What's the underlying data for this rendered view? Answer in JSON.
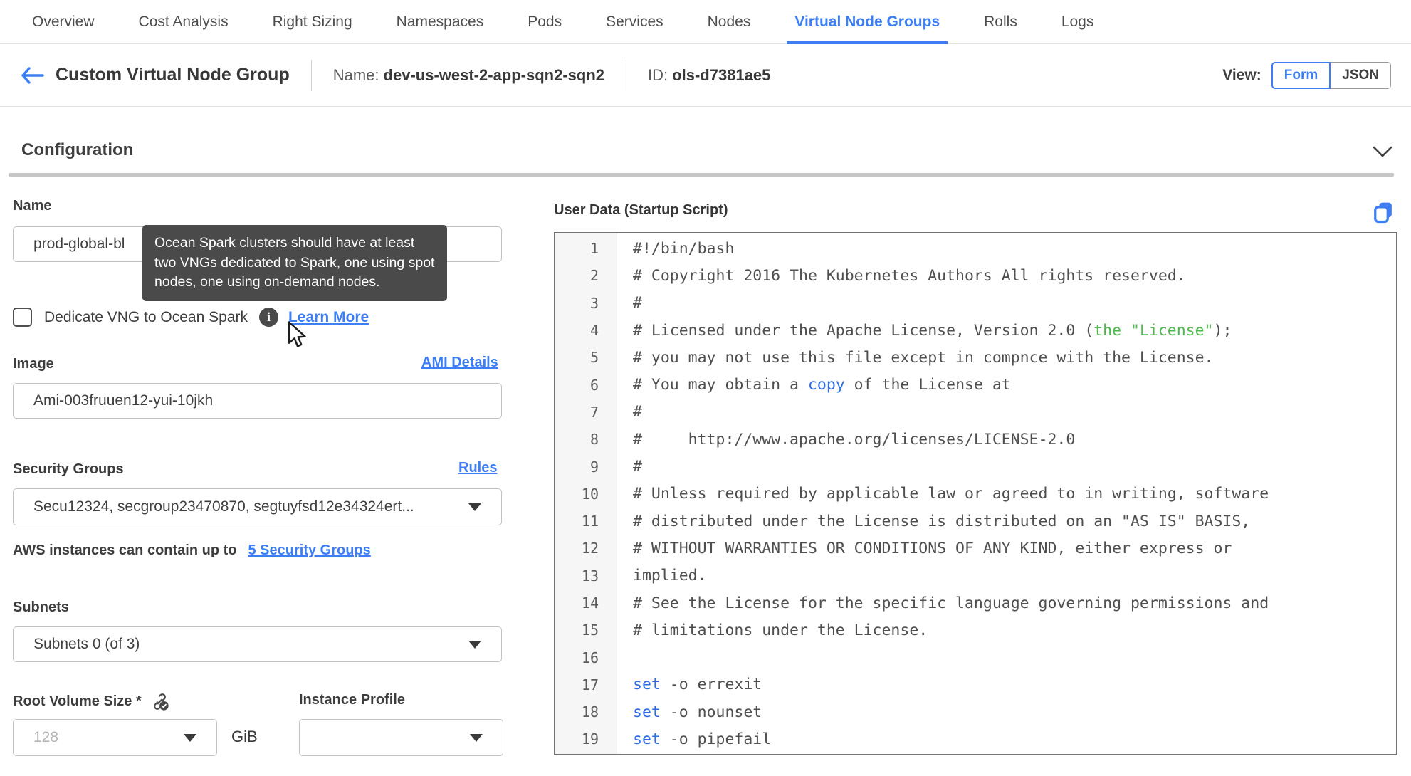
{
  "nav": {
    "tabs": [
      {
        "label": "Overview",
        "active": false
      },
      {
        "label": "Cost Analysis",
        "active": false
      },
      {
        "label": "Right Sizing",
        "active": false
      },
      {
        "label": "Namespaces",
        "active": false
      },
      {
        "label": "Pods",
        "active": false
      },
      {
        "label": "Services",
        "active": false
      },
      {
        "label": "Nodes",
        "active": false
      },
      {
        "label": "Virtual Node Groups",
        "active": true
      },
      {
        "label": "Rolls",
        "active": false
      },
      {
        "label": "Logs",
        "active": false
      }
    ]
  },
  "header": {
    "title": "Custom Virtual Node Group",
    "name_label": "Name:",
    "name_value": "dev-us-west-2-app-sqn2-sqn2",
    "id_label": "ID:",
    "id_value": "ols-d7381ae5",
    "view_label": "View:",
    "view_options": [
      "Form",
      "JSON"
    ],
    "view_selected": "Form"
  },
  "section": {
    "title": "Configuration"
  },
  "form": {
    "name": {
      "label": "Name",
      "value": "prod-global-bl"
    },
    "tooltip": "Ocean Spark clusters should have at least two VNGs dedicated to Spark, one using spot nodes, one using on-demand nodes.",
    "dedicate": {
      "label": "Dedicate VNG to Ocean Spark",
      "checked": false,
      "link": "Learn More"
    },
    "image": {
      "label": "Image",
      "link": "AMI Details",
      "value": "Ami-003fruuen12-yui-10jkh"
    },
    "security_groups": {
      "label": "Security Groups",
      "link": "Rules",
      "value": "Secu12324, secgroup23470870, segtuyfsd12e34324ert...",
      "note_text": "AWS instances can contain up to",
      "note_link": "5 Security Groups"
    },
    "subnets": {
      "label": "Subnets",
      "value": "Subnets 0 (of 3)"
    },
    "root_volume": {
      "label": "Root Volume Size *",
      "placeholder": "128",
      "unit": "GiB"
    },
    "instance_profile": {
      "label": "Instance Profile",
      "value": ""
    }
  },
  "editor": {
    "title": "User Data (Startup Script)",
    "language": "bash",
    "lines": [
      {
        "n": 1,
        "segments": [
          {
            "t": "#!/bin/bash"
          }
        ]
      },
      {
        "n": 2,
        "segments": [
          {
            "t": "# Copyright 2016 The Kubernetes Authors All rights reserved."
          }
        ]
      },
      {
        "n": 3,
        "segments": [
          {
            "t": "#"
          }
        ]
      },
      {
        "n": 4,
        "segments": [
          {
            "t": "# Licensed under the Apache License, Version 2.0 ("
          },
          {
            "t": "the \"License\"",
            "c": "green"
          },
          {
            "t": ");"
          }
        ]
      },
      {
        "n": 5,
        "segments": [
          {
            "t": "# you may not use this file except in compnce with the License."
          }
        ]
      },
      {
        "n": 6,
        "segments": [
          {
            "t": "# You may obtain a "
          },
          {
            "t": "copy",
            "c": "blue"
          },
          {
            "t": " of the License at"
          }
        ]
      },
      {
        "n": 7,
        "segments": [
          {
            "t": "#"
          }
        ]
      },
      {
        "n": 8,
        "segments": [
          {
            "t": "#     http://www.apache.org/licenses/LICENSE-2.0"
          }
        ]
      },
      {
        "n": 9,
        "segments": [
          {
            "t": "#"
          }
        ]
      },
      {
        "n": 10,
        "segments": [
          {
            "t": "# Unless required by applicable law or agreed to in writing, software"
          }
        ]
      },
      {
        "n": 11,
        "segments": [
          {
            "t": "# distributed under the License is distributed on an \"AS IS\" BASIS,"
          }
        ]
      },
      {
        "n": 12,
        "segments": [
          {
            "t": "# WITHOUT WARRANTIES OR CONDITIONS OF ANY KIND, either express or"
          }
        ]
      },
      {
        "n": 13,
        "segments": [
          {
            "t": "implied."
          }
        ]
      },
      {
        "n": 14,
        "segments": [
          {
            "t": "# See the License for the specific language governing permissions and"
          }
        ]
      },
      {
        "n": 15,
        "segments": [
          {
            "t": "# limitations under the License."
          }
        ]
      },
      {
        "n": 16,
        "segments": []
      },
      {
        "n": 17,
        "segments": [
          {
            "t": "set",
            "c": "blue"
          },
          {
            "t": " -o errexit"
          }
        ]
      },
      {
        "n": 18,
        "segments": [
          {
            "t": "set",
            "c": "blue"
          },
          {
            "t": " -o nounset"
          }
        ]
      },
      {
        "n": 19,
        "segments": [
          {
            "t": "set",
            "c": "blue"
          },
          {
            "t": " -o pipefail"
          }
        ]
      }
    ]
  },
  "colors": {
    "accent_blue": "#3d7ef5",
    "tab_active": "#3d7ef5",
    "tooltip_bg": "#4a4a4a",
    "code_default": "#4f4f4f",
    "code_green": "#4db84d",
    "code_blue": "#2d6ce5",
    "gutter_bg": "#f6f6f6"
  },
  "icons": {
    "back": "back-arrow-icon",
    "chevron": "chevron-down-icon",
    "info": "info-icon",
    "copy": "copy-icon",
    "link_badge": "link-check-icon",
    "cursor": "mouse-cursor-icon"
  }
}
